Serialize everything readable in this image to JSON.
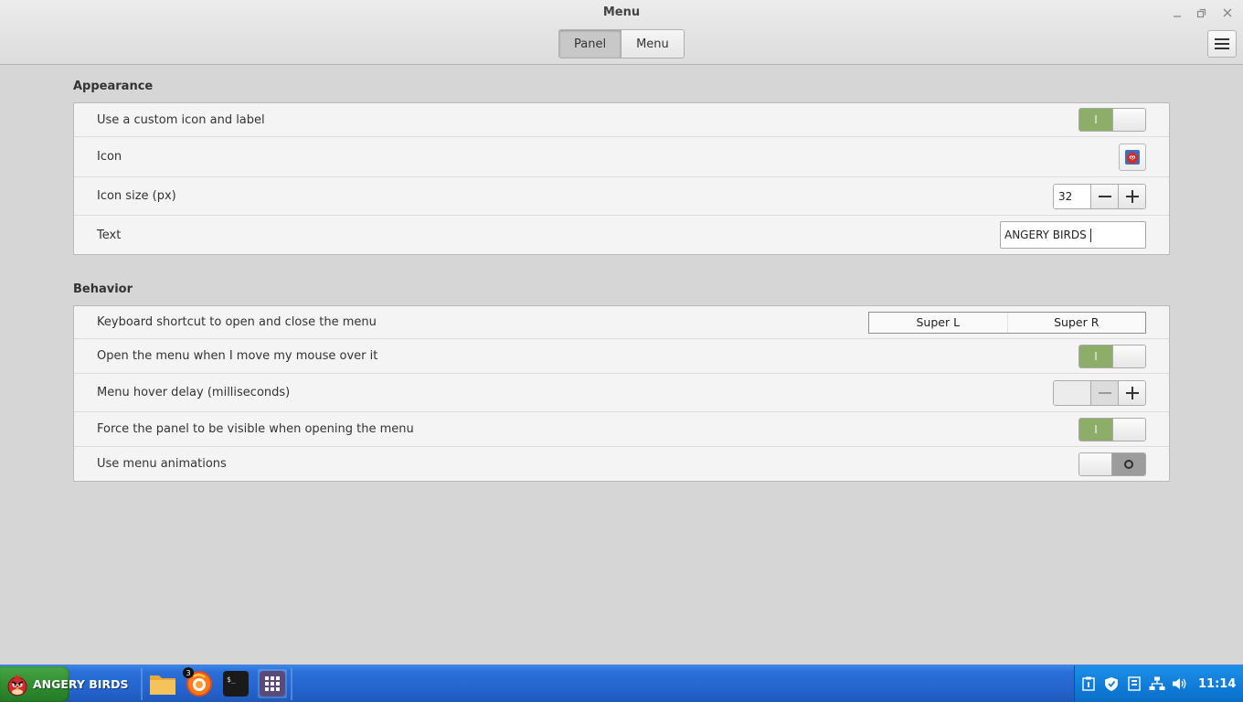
{
  "window": {
    "title": "Menu",
    "tabs": [
      {
        "label": "Panel",
        "active": true
      },
      {
        "label": "Menu",
        "active": false
      }
    ]
  },
  "appearance": {
    "heading": "Appearance",
    "custom_icon_label": "Use a custom icon and label",
    "custom_icon_state": "on",
    "custom_icon_on_glyph": "I",
    "icon_label": "Icon",
    "icon_size_label": "Icon size (px)",
    "icon_size_value": "32",
    "text_label": "Text",
    "text_value": "ANGERY BIRDS"
  },
  "behavior": {
    "heading": "Behavior",
    "shortcut_label": "Keyboard shortcut to open and close the menu",
    "shortcut_keys": [
      "Super L",
      "Super R"
    ],
    "hover_open_label": "Open the menu when I move my mouse over it",
    "hover_open_state": "on",
    "hover_open_on_glyph": "I",
    "hover_delay_label": "Menu hover delay (milliseconds)",
    "hover_delay_value": "",
    "force_visible_label": "Force the panel to be visible when opening the menu",
    "force_visible_state": "on",
    "force_visible_on_glyph": "I",
    "animations_label": "Use menu animations",
    "animations_state": "off"
  },
  "taskbar": {
    "start_label": "ANGERY BIRDS",
    "launchers": [
      "folder-icon",
      "firefox-icon",
      "terminal-icon",
      "app-grid-icon"
    ],
    "firefox_badge": "3",
    "tray_icons": [
      "clipboard-icon",
      "shield-icon",
      "update-icon",
      "network-icon",
      "volume-icon"
    ],
    "clock": "11:14"
  },
  "colors": {
    "switch_on": "#8cae68",
    "taskbar_blue": "#2463cc",
    "start_green": "#2d8a2d",
    "tray_blue": "#0f7bd8"
  }
}
